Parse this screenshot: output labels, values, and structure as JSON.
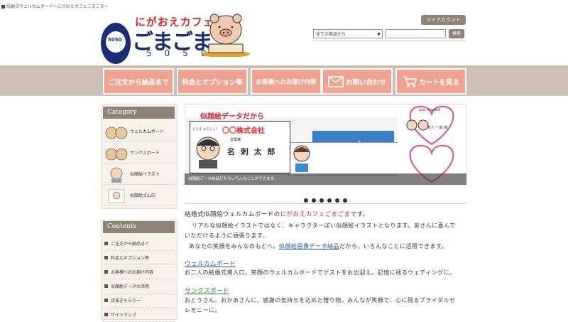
{
  "top_line": "結婚式ウェルカムボード～にがおえカフェごまごま～",
  "logo": {
    "tagline": "にがおえカフェ",
    "main": "ごまごま",
    "num": "5050",
    "cup_text": "5050"
  },
  "header": {
    "account_label": "マイアカウント",
    "search_select": "全ての商品から",
    "search_placeholder": "",
    "search_button": "検索"
  },
  "nav": [
    {
      "label": "ご注文から納品まで"
    },
    {
      "label": "料金とオプション等"
    },
    {
      "label": "お客様へのお届け内容"
    },
    {
      "label": "お問い合わせ"
    },
    {
      "label": "カートを見る"
    }
  ],
  "sidebar": {
    "category_title": "Category",
    "categories": [
      "ウェルカムボード",
      "サンクスボード",
      "似顔絵イラスト",
      "似顔絵ゴム印"
    ],
    "contents_title": "Contents",
    "contents": [
      "ご注文から納品まで",
      "料金とオプション等",
      "お客様へのお届け内容",
      "似顔絵データの活用",
      "店長ぎゃらりー",
      "サイトマップ"
    ]
  },
  "slider": {
    "title": "似顔絵データだから",
    "card_company": "〇〇株式会社",
    "card_dept": "営業課",
    "card_name": "名 刺 太 郎",
    "card_greeting": "どうぞ よろしく!",
    "jm_title": "just married",
    "jm_name": "友人 一郎 様",
    "caption": "似顔絵データ納品だからいろんなことができます。"
  },
  "main": {
    "intro_prefix": "結婚式似顔絵ウェルカムボードの",
    "intro_brand": "にがおえカフェごまごま",
    "intro_suffix": "です。",
    "line2": "リアルな似顔絵イラストではなく、キャラクターぽい似顔絵イラストとなります。皆さんに喜んで",
    "line3": "いただけるように頑張ります。",
    "line4_prefix": "あなたの笑顔をみんなのもとへ。",
    "line4_link": "似顔絵画像データ納品",
    "line4_suffix": "だから、いろんなことに活用できます。",
    "welcome_heading": "ウェルカムボード",
    "welcome_text": "お二人の結婚式場入口。笑顔のウェルカムボードでゲストをお出迎え。記憶に残るウェディングに。",
    "thanks_heading": "サンクスボード",
    "thanks_text1": "おとうさん、おかあさんに、感謝の気持ちを込めた贈り物。みんなが笑顔で、心に残るブライダルセ",
    "thanks_text2": "レモニーに。"
  },
  "colors": {
    "accent": "#f0a48f",
    "band": "#ccbfb6",
    "sidebar_head": "#8d8378",
    "brand_red": "#e0252b",
    "link_blue": "#1a55c8",
    "link_green": "#1f8a2e"
  }
}
